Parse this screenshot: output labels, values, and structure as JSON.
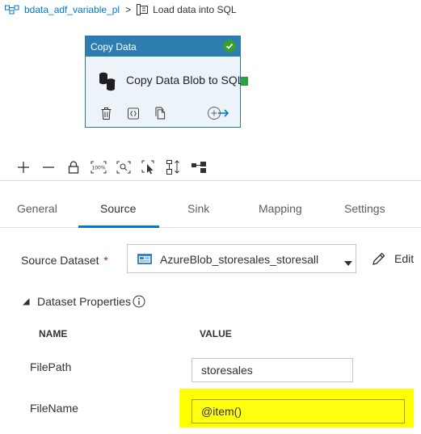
{
  "breadcrumb": {
    "pipeline": "bdata_adf_variable_pl",
    "separator": ">",
    "activity": "Load data into SQL",
    "pipeline_icon": "pipeline-icon",
    "activity_icon": "activity-icon"
  },
  "activity_card": {
    "type_label": "Copy Data",
    "name": "Copy Data Blob to SQL",
    "status_icon": "success-check-icon",
    "status_color": "#35a02e",
    "header_color": "#2d7db1",
    "actions": [
      "delete-icon",
      "code-icon",
      "copy-icon",
      "add-output-icon"
    ]
  },
  "canvas_toolbar": {
    "buttons": [
      "add-icon",
      "remove-icon",
      "lock-icon",
      "zoom-100-icon",
      "zoom-fit-icon",
      "select-icon",
      "auto-align-icon",
      "layout-icon"
    ],
    "zoom_label": "100%"
  },
  "tabs": {
    "items": [
      "General",
      "Source",
      "Sink",
      "Mapping",
      "Settings"
    ],
    "active": "Source"
  },
  "source": {
    "dataset_label": "Source Dataset",
    "required_marker": "*",
    "dataset_value": "AzureBlob_storesales_storesall",
    "edit_label": "Edit"
  },
  "dataset_properties": {
    "title": "Dataset Properties",
    "columns": {
      "name": "NAME",
      "value": "VALUE"
    },
    "rows": [
      {
        "name": "FilePath",
        "value": "storesales"
      },
      {
        "name": "FileName",
        "value": "@item()"
      }
    ]
  },
  "colors": {
    "accent": "#0078d4",
    "highlight": "#ffff00"
  }
}
